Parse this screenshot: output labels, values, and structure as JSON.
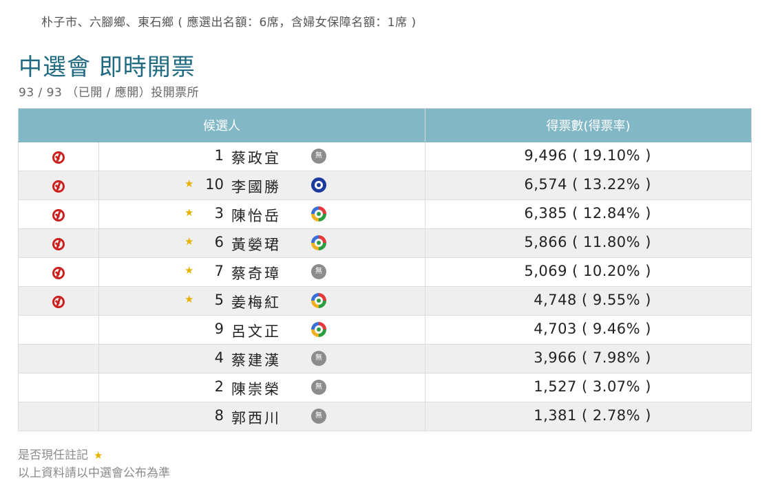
{
  "header": {
    "district": "朴子市、六腳鄉、東石鄉 (  應選出名額：6席，含婦女保障名額：1席  )",
    "title": "中選會 即時開票",
    "stations": "93 / 93 （已開 / 應開）投開票所"
  },
  "table": {
    "col_candidate": "候選人",
    "col_votes": "得票數(得票率)"
  },
  "candidates": [
    {
      "elected": true,
      "incumbent": false,
      "number": "1",
      "name": "蔡政宜",
      "party": "無",
      "party_icon": "none-party-icon",
      "votes": "9,496 ( 19.10% )"
    },
    {
      "elected": true,
      "incumbent": true,
      "number": "10",
      "name": "李國勝",
      "party": "",
      "party_icon": "kmt-party-icon",
      "votes": "6,574 ( 13.22% )"
    },
    {
      "elected": true,
      "incumbent": true,
      "number": "3",
      "name": "陳怡岳",
      "party": "",
      "party_icon": "dpp-party-icon",
      "votes": "6,385 ( 12.84% )"
    },
    {
      "elected": true,
      "incumbent": true,
      "number": "6",
      "name": "黃嫈珺",
      "party": "",
      "party_icon": "dpp-party-icon",
      "votes": "5,866 ( 11.80% )"
    },
    {
      "elected": true,
      "incumbent": true,
      "number": "7",
      "name": "蔡奇璋",
      "party": "無",
      "party_icon": "none-party-icon",
      "votes": "5,069 ( 10.20% )"
    },
    {
      "elected": true,
      "incumbent": true,
      "number": "5",
      "name": "姜梅紅",
      "party": "",
      "party_icon": "dpp-party-icon",
      "votes": "4,748 ( 9.55% )"
    },
    {
      "elected": false,
      "incumbent": false,
      "number": "9",
      "name": "呂文正",
      "party": "",
      "party_icon": "dpp-party-icon",
      "votes": "4,703 ( 9.46% )"
    },
    {
      "elected": false,
      "incumbent": false,
      "number": "4",
      "name": "蔡建漢",
      "party": "無",
      "party_icon": "none-party-icon",
      "votes": "3,966 ( 7.98% )"
    },
    {
      "elected": false,
      "incumbent": false,
      "number": "2",
      "name": "陳崇榮",
      "party": "無",
      "party_icon": "none-party-icon",
      "votes": "1,527 ( 3.07% )"
    },
    {
      "elected": false,
      "incumbent": false,
      "number": "8",
      "name": "郭西川",
      "party": "無",
      "party_icon": "none-party-icon",
      "votes": "1,381 ( 2.78% )"
    }
  ],
  "footer": {
    "incumbent_note": "是否現任註記",
    "incumbent_star": "★",
    "disclaimer": "以上資料請以中選會公布為準"
  },
  "colors": {
    "header_bg": "#82b7c6",
    "title": "#1f6a80",
    "elected_mark": "#cc1f1f",
    "star": "#e5b200"
  }
}
